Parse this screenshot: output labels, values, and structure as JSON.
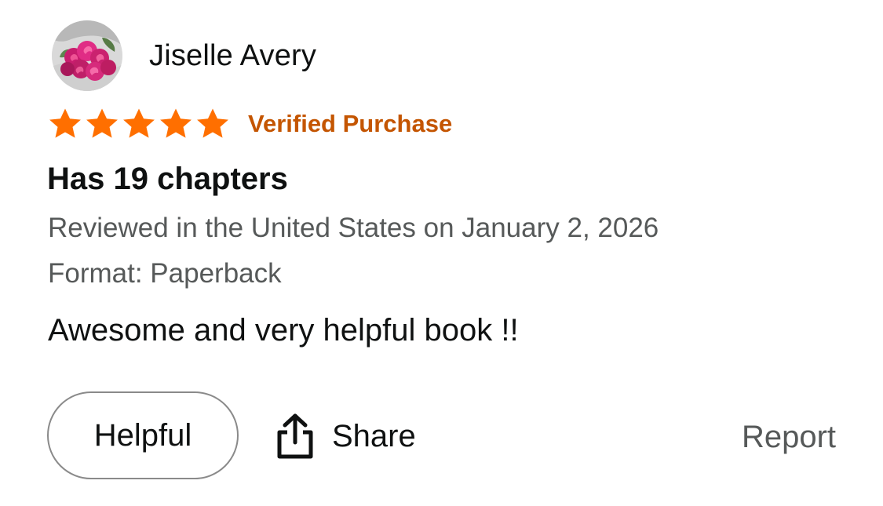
{
  "reviewer": {
    "name": "Jiselle Avery",
    "avatar_icon": "rose-bouquet-avatar-icon"
  },
  "rating": {
    "value": 5,
    "max": 5,
    "star_color": "#ff6f00",
    "verified_label": "Verified Purchase",
    "verified_color": "#c45500"
  },
  "review": {
    "title": "Has 19 chapters",
    "meta": "Reviewed in the United States on January 2, 2026",
    "format": "Format: Paperback",
    "body": "Awesome and very helpful book !!"
  },
  "actions": {
    "helpful_label": "Helpful",
    "share_label": "Share",
    "share_icon": "share-upload-icon",
    "report_label": "Report"
  }
}
